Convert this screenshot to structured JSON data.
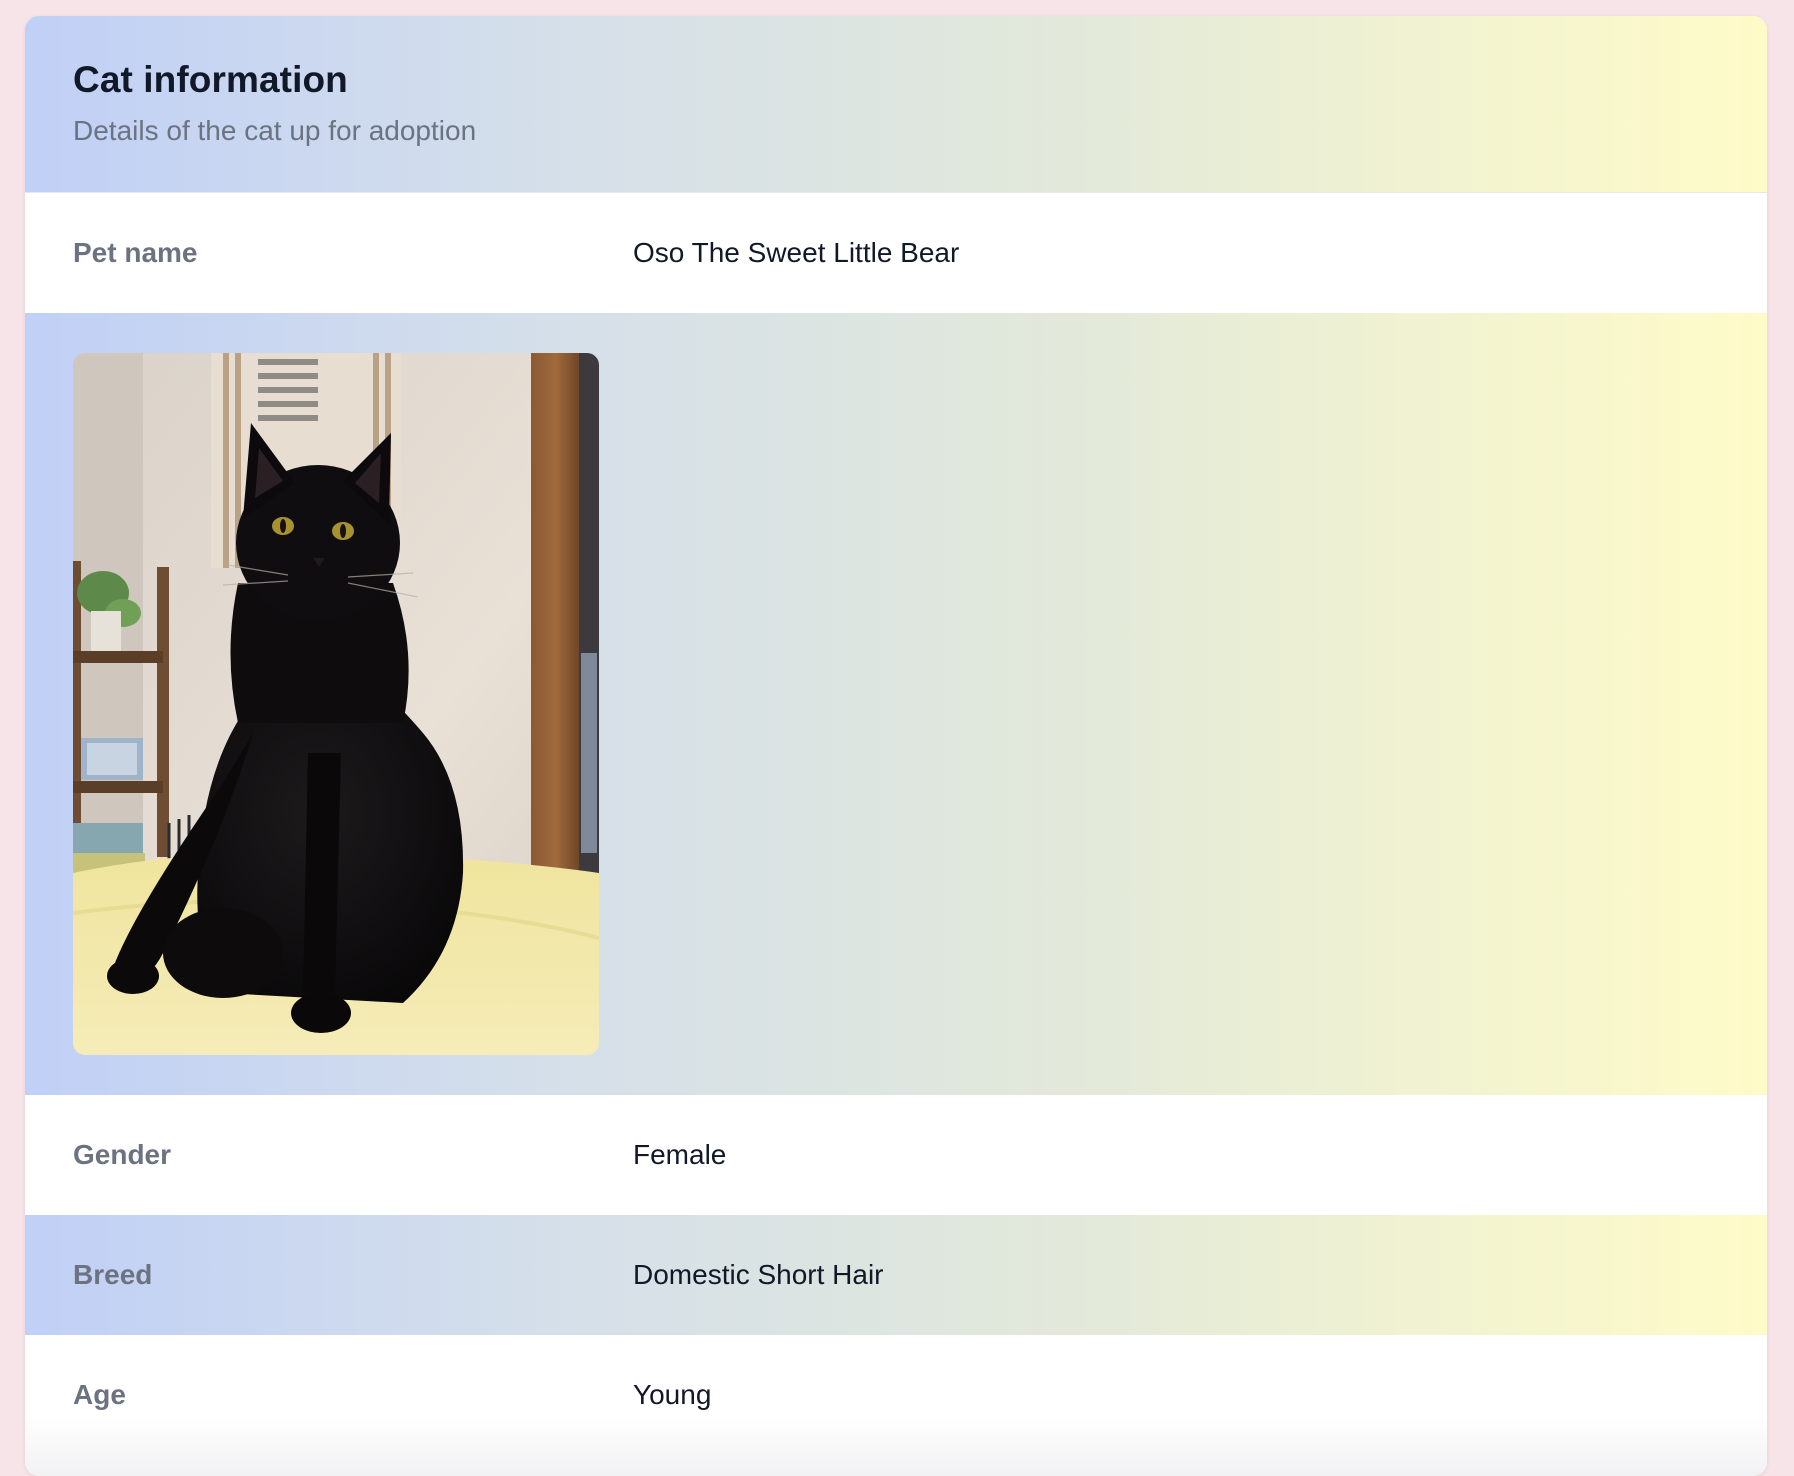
{
  "card": {
    "title": "Cat information",
    "subtitle": "Details of the cat up for adoption"
  },
  "photo": {
    "icon": "black-cat-photo",
    "alt": "Photo of Oso The Sweet Little Bear"
  },
  "fields": {
    "pet_name": {
      "label": "Pet name",
      "value": "Oso The Sweet Little Bear"
    },
    "gender": {
      "label": "Gender",
      "value": "Female"
    },
    "breed": {
      "label": "Breed",
      "value": "Domestic Short Hair"
    },
    "age": {
      "label": "Age",
      "value": "Young"
    }
  },
  "colors": {
    "page_background": "#f7e4e8",
    "gradient_start": "#c0d0f6",
    "gradient_end": "#fffbc8",
    "label_text": "#6b7280",
    "value_text": "#111827"
  }
}
